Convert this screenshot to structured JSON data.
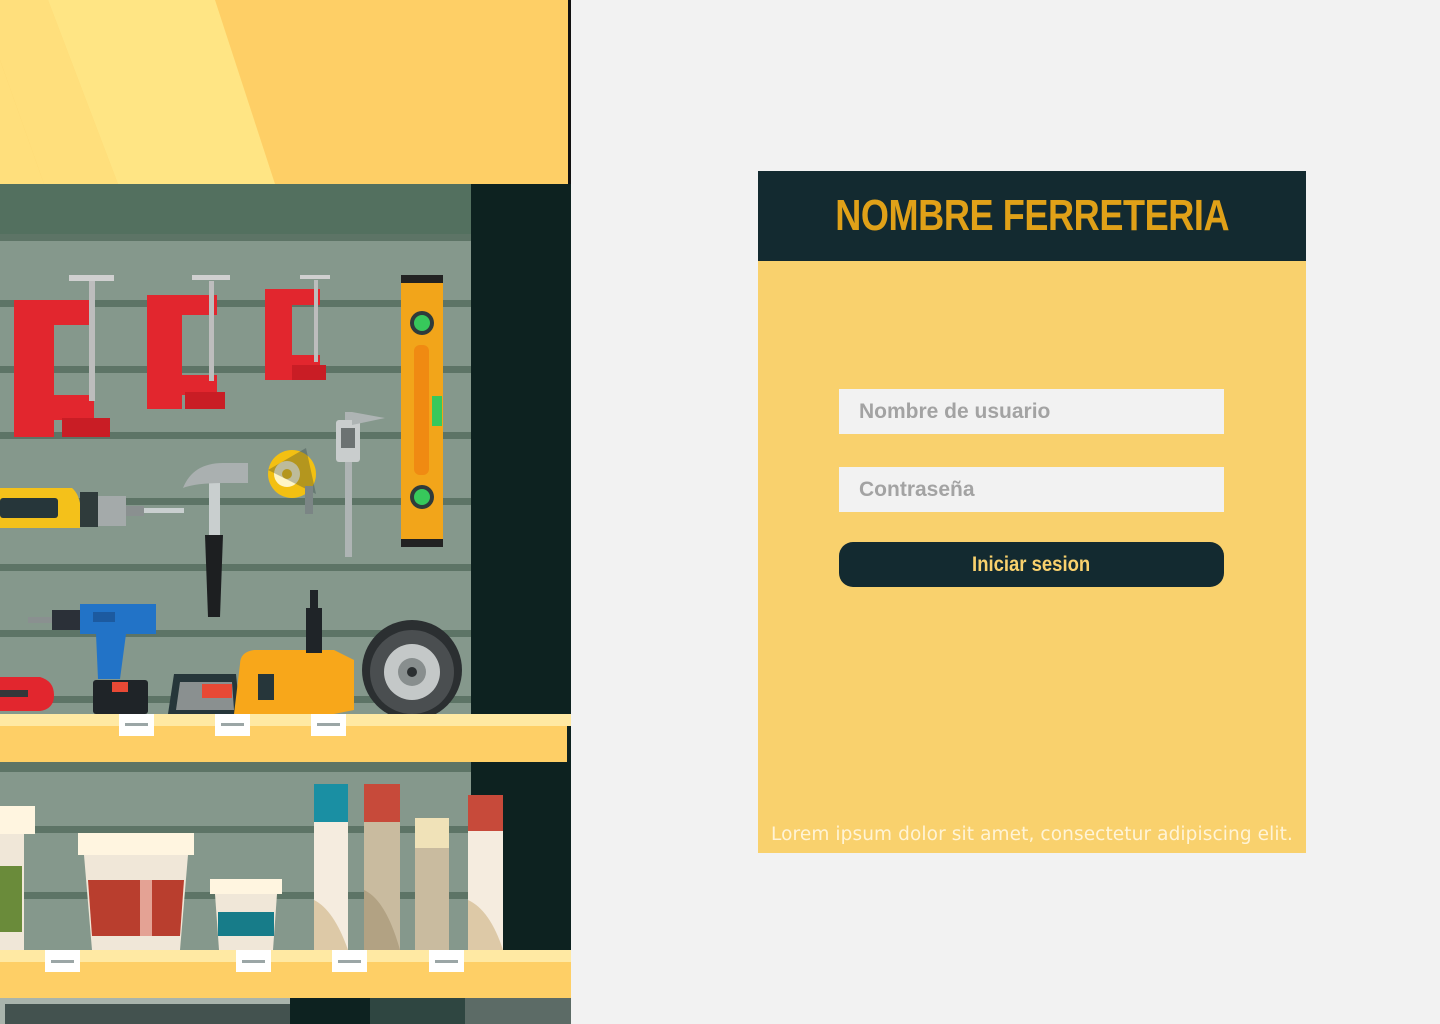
{
  "login": {
    "title": "NOMBRE FERRETERIA",
    "username_placeholder": "Nombre de usuario",
    "password_placeholder": "Contraseña",
    "submit_label": "Iniciar sesion",
    "footer": "Lorem ipsum dolor sit amet, consectetur adipiscing elit."
  },
  "colors": {
    "card_background": "#f9d16d",
    "header_background": "#132a30",
    "title_color": "#e0a118",
    "button_background": "#132a30",
    "button_text": "#f9d16d",
    "page_background": "#f2f2f2"
  },
  "illustration": {
    "name": "hardware-store-shelf",
    "items": [
      "c-clamp-icon",
      "spirit-level-icon",
      "power-drill-icon",
      "hammer-icon",
      "tape-measure-icon",
      "caliper-icon",
      "cordless-drill-icon",
      "angle-grinder-icon",
      "paint-bucket-icon",
      "spray-can-icon"
    ]
  }
}
